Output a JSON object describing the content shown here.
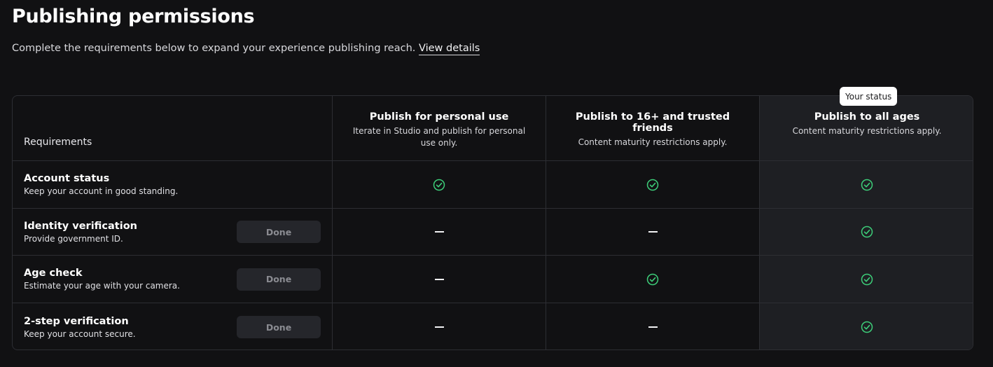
{
  "header": {
    "title": "Publishing permissions",
    "subtitle": "Complete the requirements below to expand your experience publishing reach.",
    "link_label": "View details"
  },
  "status_badge": "Your status",
  "table": {
    "requirements_label": "Requirements",
    "tiers": [
      {
        "name": "Publish for personal use",
        "desc": "Iterate in Studio and publish for personal use only."
      },
      {
        "name": "Publish to 16+ and trusted friends",
        "desc": "Content maturity restrictions apply."
      },
      {
        "name": "Publish to all ages",
        "desc": "Content maturity restrictions apply."
      }
    ],
    "rows": [
      {
        "name": "Account status",
        "desc": "Keep your account in good standing.",
        "button": null,
        "status": [
          "check",
          "check",
          "check"
        ]
      },
      {
        "name": "Identity verification",
        "desc": "Provide government ID.",
        "button": "Done",
        "status": [
          "dash",
          "dash",
          "check"
        ]
      },
      {
        "name": "Age check",
        "desc": "Estimate your age with your camera.",
        "button": "Done",
        "status": [
          "dash",
          "check",
          "check"
        ]
      },
      {
        "name": "2-step verification",
        "desc": "Keep your account secure.",
        "button": "Done",
        "status": [
          "dash",
          "dash",
          "check"
        ]
      }
    ]
  },
  "icons": {
    "check": "check-circle-icon",
    "dash": "dash-icon"
  },
  "colors": {
    "background": "#111113",
    "highlight": "#1e1f23",
    "border": "#2d2e33",
    "check": "#3dcc78",
    "button_bg": "#25262b",
    "button_text": "#8a8b91"
  }
}
